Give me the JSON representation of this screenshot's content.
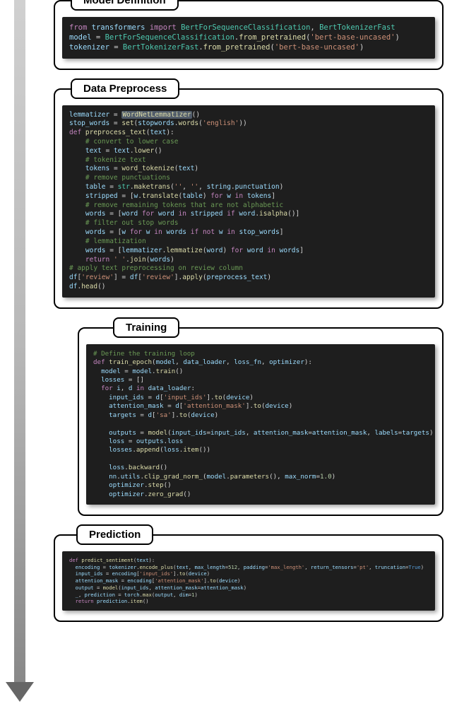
{
  "sections": {
    "model_definition": {
      "label": "Model Definition"
    },
    "data_preprocess": {
      "label": "Data Preprocess"
    },
    "training": {
      "label": "Training"
    },
    "prediction": {
      "label": "Prediction"
    }
  },
  "code": {
    "model_definition": {
      "l1_from": "from",
      "l1_mod": "transformers",
      "l1_import": "import",
      "l1_c1": "BertForSequenceClassification",
      "l1_c2": "BertTokenizerFast",
      "l2_var": "model",
      "l2_cls": "BertForSequenceClassification",
      "l2_fn": "from_pretrained",
      "l2_arg": "'bert-base-uncased'",
      "l3_var": "tokenizer",
      "l3_cls": "BertTokenizerFast",
      "l3_fn": "from_pretrained",
      "l3_arg": "'bert-base-uncased'"
    },
    "data_preprocess": {
      "l01_var": "lemmatizer",
      "l01_cls": "WordNetLemmatizer",
      "l02_var": "stop_words",
      "l02_fn": "set",
      "l02_m": "stopwords",
      "l02_fn2": "words",
      "l02_arg": "'english'",
      "l03_def": "def",
      "l03_name": "preprocess_text",
      "l03_p": "text",
      "l04_c": "# convert to lower case",
      "l05_v": "text",
      "l05_r": "text",
      "l05_fn": "lower",
      "l06_c": "# tokenize text",
      "l07_v": "tokens",
      "l07_fn": "word_tokenize",
      "l07_a": "text",
      "l08_c": "# remove punctuations",
      "l09_v": "table",
      "l09_o": "str",
      "l09_fn": "maketrans",
      "l09_a1": "''",
      "l09_a2": "''",
      "l09_a3": "string",
      "l09_a4": "punctuation",
      "l10_v": "stripped",
      "l10_w": "w",
      "l10_fn": "translate",
      "l10_a": "table",
      "l10_for": "for",
      "l10_in": "in",
      "l10_src": "tokens",
      "l11_c": "# remove remaining tokens that are not alphabetic",
      "l12_v": "words",
      "l12_w": "word",
      "l12_for": "for",
      "l12_in": "in",
      "l12_src": "stripped",
      "l12_if": "if",
      "l12_fn": "isalpha",
      "l13_c": "# filter out stop words",
      "l14_v": "words",
      "l14_w": "w",
      "l14_for": "for",
      "l14_in": "in",
      "l14_src": "words",
      "l14_if": "if",
      "l14_not": "not",
      "l14_sw": "stop_words",
      "l15_c": "# lemmatization",
      "l16_v": "words",
      "l16_o": "lemmatizer",
      "l16_fn": "lemmatize",
      "l16_a": "word",
      "l16_for": "for",
      "l16_w": "word",
      "l16_in": "in",
      "l16_src": "words",
      "l17_ret": "return",
      "l17_s": "' '",
      "l17_fn": "join",
      "l17_a": "words",
      "l18_c": "# apply text preprocessing on review column",
      "l19_d": "df",
      "l19_k": "'review'",
      "l19_fn": "apply",
      "l19_a": "preprocess_text",
      "l20_d": "df",
      "l20_fn": "head"
    },
    "training": {
      "l01_c": "# Define the training loop",
      "l02_def": "def",
      "l02_name": "train_epoch",
      "l02_p1": "model",
      "l02_p2": "data_loader",
      "l02_p3": "loss_fn",
      "l02_p4": "optimizer",
      "l03_v": "model",
      "l03_r": "model",
      "l03_fn": "train",
      "l04_v": "losses",
      "l05_for": "for",
      "l05_i": "i",
      "l05_d": "d",
      "l05_in": "in",
      "l05_src": "data_loader",
      "l06_v": "input_ids",
      "l06_d": "d",
      "l06_k": "'input_ids'",
      "l06_fn": "to",
      "l06_a": "device",
      "l07_v": "attention_mask",
      "l07_d": "d",
      "l07_k": "'attention_mask'",
      "l07_fn": "to",
      "l07_a": "device",
      "l08_v": "targets",
      "l08_d": "d",
      "l08_k": "'sa'",
      "l08_fn": "to",
      "l08_a": "device",
      "l09_v": "outputs",
      "l09_fn": "model",
      "l09_kw1": "input_ids",
      "l09_a1": "input_ids",
      "l09_kw2": "attention_mask",
      "l09_a2": "attention_mask",
      "l09_kw3": "labels",
      "l09_a3": "targets",
      "l10_v": "loss",
      "l10_o": "outputs",
      "l10_a": "loss",
      "l11_o": "losses",
      "l11_fn": "append",
      "l11_a": "loss",
      "l11_fn2": "item",
      "l12_o": "loss",
      "l12_fn": "backward",
      "l13_o": "nn",
      "l13_m": "utils",
      "l13_fn": "clip_grad_norm_",
      "l13_a1": "model",
      "l13_fn2": "parameters",
      "l13_kw": "max_norm",
      "l13_n": "1.0",
      "l14_o": "optimizer",
      "l14_fn": "step",
      "l15_o": "optimizer",
      "l15_fn": "zero_grad"
    },
    "prediction": {
      "l1_def": "def",
      "l1_name": "predict_sentiment",
      "l1_p": "text",
      "l2_v": "encoding",
      "l2_o": "tokenizer",
      "l2_fn": "encode_plus",
      "l2_a": "text",
      "l2_kw1": "max_length",
      "l2_n1": "512",
      "l2_kw2": "padding",
      "l2_s2": "'max_length'",
      "l2_kw3": "return_tensors",
      "l2_s3": "'pt'",
      "l2_kw4": "truncation",
      "l2_b4": "True",
      "l3_v": "input_ids",
      "l3_o": "encoding",
      "l3_k": "'input_ids'",
      "l3_fn": "to",
      "l3_a": "device",
      "l4_v": "attention_mask",
      "l4_o": "encoding",
      "l4_k": "'attention_mask'",
      "l4_fn": "to",
      "l4_a": "device",
      "l5_v": "output",
      "l5_fn": "model",
      "l5_a1": "input_ids",
      "l5_kw": "attention_mask",
      "l5_a2": "attention_mask",
      "l6_v1": "_",
      "l6_v2": "prediction",
      "l6_o": "torch",
      "l6_fn": "max",
      "l6_a": "output",
      "l6_kw": "dim",
      "l6_n": "1",
      "l7_ret": "return",
      "l7_o": "prediction",
      "l7_fn": "item"
    }
  }
}
